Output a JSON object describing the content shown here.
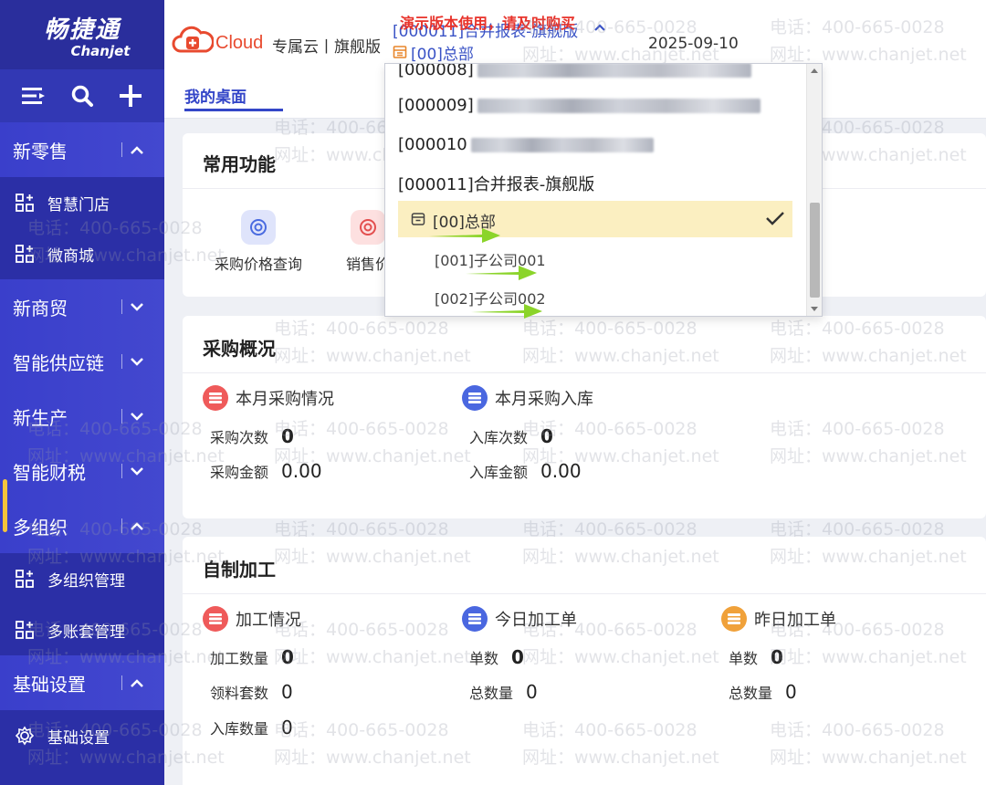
{
  "sidebar": {
    "logo_cn": "畅捷通",
    "logo_en": "Chanjet",
    "tools": [
      "menu-icon",
      "search-icon",
      "plus-icon"
    ],
    "sections": [
      {
        "label": "新零售",
        "state": "expanded"
      },
      {
        "label": "智慧门店"
      },
      {
        "label": "微商城"
      },
      {
        "label": "新商贸",
        "state": "collapsed"
      },
      {
        "label": "智能供应链",
        "state": "collapsed"
      },
      {
        "label": "新生产",
        "state": "collapsed"
      },
      {
        "label": "智能财税",
        "state": "collapsed"
      },
      {
        "label": "多组织",
        "state": "expanded"
      },
      {
        "label": "多组织管理"
      },
      {
        "label": "多账套管理"
      },
      {
        "label": "基础设置",
        "state": "expanded"
      },
      {
        "label": "基础设置"
      }
    ]
  },
  "topbar": {
    "cloud": "Cloud",
    "brand": "专属云丨旗舰版",
    "account": "[000011]合并报表-旗舰版",
    "demo_warning": "演示版本使用，请及时购买",
    "org": "[00]总部",
    "date": "2025-09-10"
  },
  "tabs": {
    "active": "我的桌面"
  },
  "common_functions": {
    "title": "常用功能",
    "items": [
      "采购价格查询",
      "销售价"
    ]
  },
  "purchase": {
    "title": "采购概况",
    "left_head": "本月采购情况",
    "left_rows": [
      {
        "label": "采购次数",
        "value": "0"
      },
      {
        "label": "采购金额",
        "value": "0.00"
      }
    ],
    "right_head": "本月采购入库",
    "right_rows": [
      {
        "label": "入库次数",
        "value": "0"
      },
      {
        "label": "入库金额",
        "value": "0.00"
      }
    ]
  },
  "manufacturing": {
    "title": "自制加工",
    "col1_head": "加工情况",
    "col1_rows": [
      {
        "label": "加工数量",
        "value": "0"
      },
      {
        "label": "领料套数",
        "value": "0"
      },
      {
        "label": "入库数量",
        "value": "0"
      }
    ],
    "col2_head": "今日加工单",
    "col2_rows": [
      {
        "label": "单数",
        "value": "0"
      },
      {
        "label": "总数量",
        "value": "0"
      }
    ],
    "col3_head": "昨日加工单",
    "col3_rows": [
      {
        "label": "单数",
        "value": "0"
      },
      {
        "label": "总数量",
        "value": "0"
      }
    ]
  },
  "dropdown": {
    "items": [
      "[000008]",
      "[000009]",
      "[000010",
      "[000011]合并报表-旗舰版"
    ],
    "selected": "[00]总部",
    "children": [
      "[001]子公司001",
      "[002]子公司002"
    ]
  },
  "watermark": {
    "phone": "电话：400-665-0028",
    "site": "网址：www.chanjet.net"
  },
  "colors": {
    "sidebar": "#2b2fa6",
    "accent": "#3446c8",
    "warning": "#e8332b",
    "selected_row": "#fbefc1",
    "arrow": "#8bd42a"
  }
}
